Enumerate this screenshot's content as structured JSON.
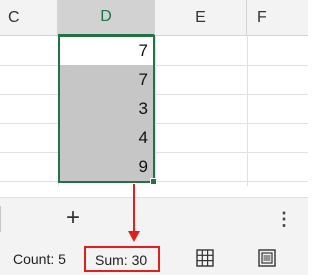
{
  "columns": [
    "C",
    "D",
    "E",
    "F"
  ],
  "cells": [
    "7",
    "7",
    "3",
    "4",
    "9"
  ],
  "sheet_bar": {
    "add_sheet_label": "+",
    "more_options_label": "⋮"
  },
  "status_bar": {
    "count": "Count: 5",
    "sum": "Sum: 30"
  },
  "colors": {
    "selection": "#217346",
    "highlight": "#e0201d"
  },
  "icons": {
    "add_sheet": "plus-icon",
    "more_options": "vertical-ellipsis-icon",
    "normal_view": "grid-icon",
    "page_layout_view": "page-layout-icon"
  }
}
